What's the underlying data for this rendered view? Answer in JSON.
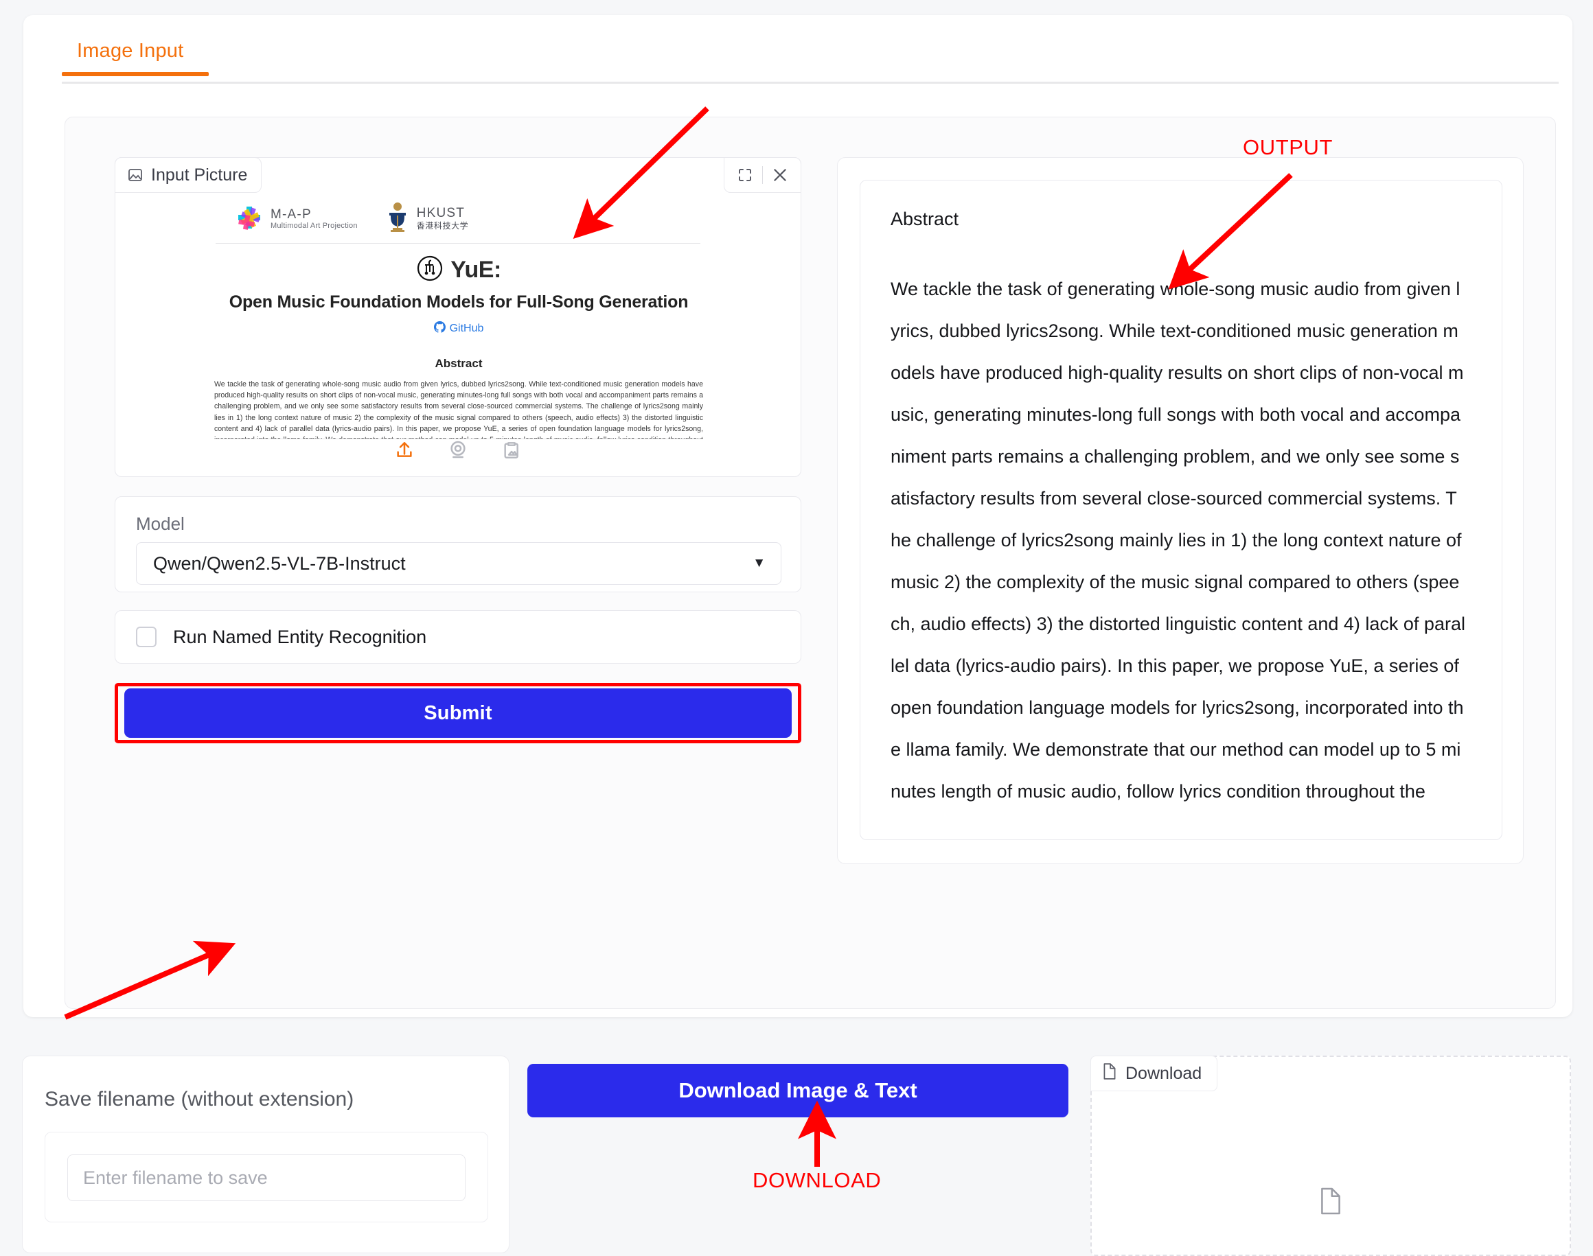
{
  "tab": {
    "label": "Image Input"
  },
  "image_component": {
    "label": "Input Picture",
    "fullscreen_icon": "fullscreen-icon",
    "close_icon": "close-icon",
    "actions": [
      "upload-icon",
      "webcam-icon",
      "paste-image-icon"
    ]
  },
  "paper_preview": {
    "org1_name": "M-A-P",
    "org1_sub": "Multimodal Art Projection",
    "org2_name": "HKUST",
    "org2_sub": "香港科技大学",
    "brand": "YuE:",
    "title": "Open Music Foundation Models for Full-Song Generation",
    "github_label": "GitHub",
    "abstract_heading": "Abstract",
    "abstract": "We tackle the task of generating whole-song music audio from given lyrics, dubbed lyrics2song. While text-conditioned music generation models have produced high-quality results on short clips of non-vocal music, generating minutes-long full songs with both vocal and accompaniment parts remains a challenging problem, and we only see some satisfactory results from several close-sourced commercial systems. The challenge of lyrics2song mainly lies in 1) the long context nature of music 2) the complexity of the music signal compared to others (speech, audio effects) 3) the distorted linguistic content and 4) lack of parallel data (lyrics-audio pairs). In this paper, we propose YuE, a series of open foundation language models for lyrics2song, incorporated into the llama family. We demonstrate that our method can model up to 5 minutes length of music audio, follow lyrics condition throughout the"
  },
  "model": {
    "label": "Model",
    "selected": "Qwen/Qwen2.5-VL-7B-Instruct",
    "caret_icon": "chevron-down-icon"
  },
  "ner": {
    "label": "Run Named Entity Recognition",
    "checked": false
  },
  "submit": {
    "label": "Submit"
  },
  "output": {
    "title": "Abstract",
    "text": "We tackle the task of generating whole-song music audio from given l\nyrics, dubbed lyrics2song. While text-conditioned music generation m\nodels have produced high-quality results on short clips of non-vocal m\nusic, generating minutes-long full songs with both vocal and accompa\nniment parts remains a challenging problem, and we only see some s\natisfactory results from several close-sourced commercial systems. T\nhe challenge of lyrics2song mainly lies in 1) the long context nature of\nmusic 2) the complexity of the music signal compared to others (spee\nch, audio effects) 3) the distorted linguistic content and 4) lack of paral\nlel data (lyrics-audio pairs). In this paper, we propose YuE, a series of\nopen foundation language models for lyrics2song, incorporated into th\ne llama family. We demonstrate that our method can model up to 5 mi\nnutes length of music audio, follow lyrics condition throughout the"
  },
  "save": {
    "label": "Save filename (without extension)",
    "placeholder": "Enter filename to save",
    "value": ""
  },
  "download_button": {
    "label": "Download Image & Text"
  },
  "download_drop": {
    "label": "Download",
    "file_icon": "file-icon"
  },
  "annotations": {
    "output_label": "OUTPUT",
    "download_label": "DOWNLOAD"
  },
  "colors": {
    "accent_orange": "#f4700c",
    "primary_blue": "#2b2beb",
    "annotation_red": "#ff0000",
    "link_blue": "#2a7ae2"
  }
}
